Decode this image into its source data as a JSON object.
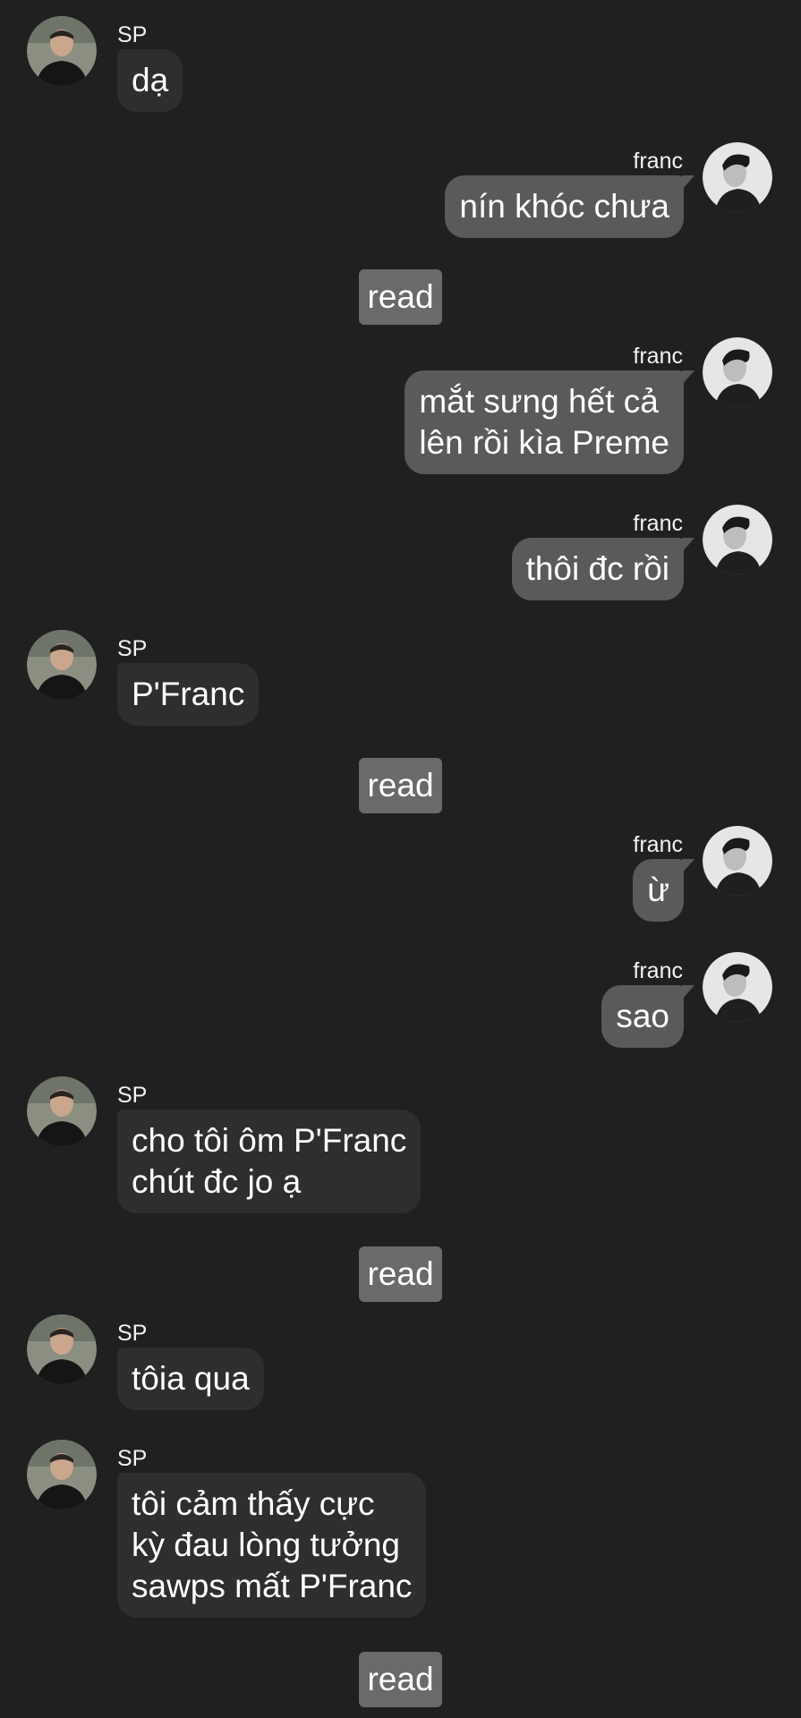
{
  "conversation": {
    "messages": [
      {
        "sender": "SP",
        "side": "left",
        "text": "dạ"
      },
      {
        "sender": "franc",
        "side": "right",
        "text": "nín khóc chưa"
      },
      {
        "status": "read"
      },
      {
        "sender": "franc",
        "side": "right",
        "text": "mắt sưng hết cả\nlên rồi kìa Preme"
      },
      {
        "sender": "franc",
        "side": "right",
        "text": "thôi đc rồi"
      },
      {
        "sender": "SP",
        "side": "left",
        "text": "P'Franc"
      },
      {
        "status": "read"
      },
      {
        "sender": "franc",
        "side": "right",
        "text": "ừ"
      },
      {
        "sender": "franc",
        "side": "right",
        "text": "sao"
      },
      {
        "sender": "SP",
        "side": "left",
        "text": "cho tôi ôm P'Franc\nchút đc jo ạ"
      },
      {
        "status": "read"
      },
      {
        "sender": "SP",
        "side": "left",
        "text": "tôia qua"
      },
      {
        "sender": "SP",
        "side": "left",
        "text": "tôi cảm thấy cực\nkỳ đau lòng tưởng\nsawps mất P'Franc"
      },
      {
        "status": "read"
      }
    ]
  },
  "colors": {
    "background": "#202020",
    "incoming_bubble": "#2e2e2e",
    "outgoing_bubble": "#5a5a5a",
    "read_badge": "#6a6a6a",
    "text": "#ffffff"
  }
}
